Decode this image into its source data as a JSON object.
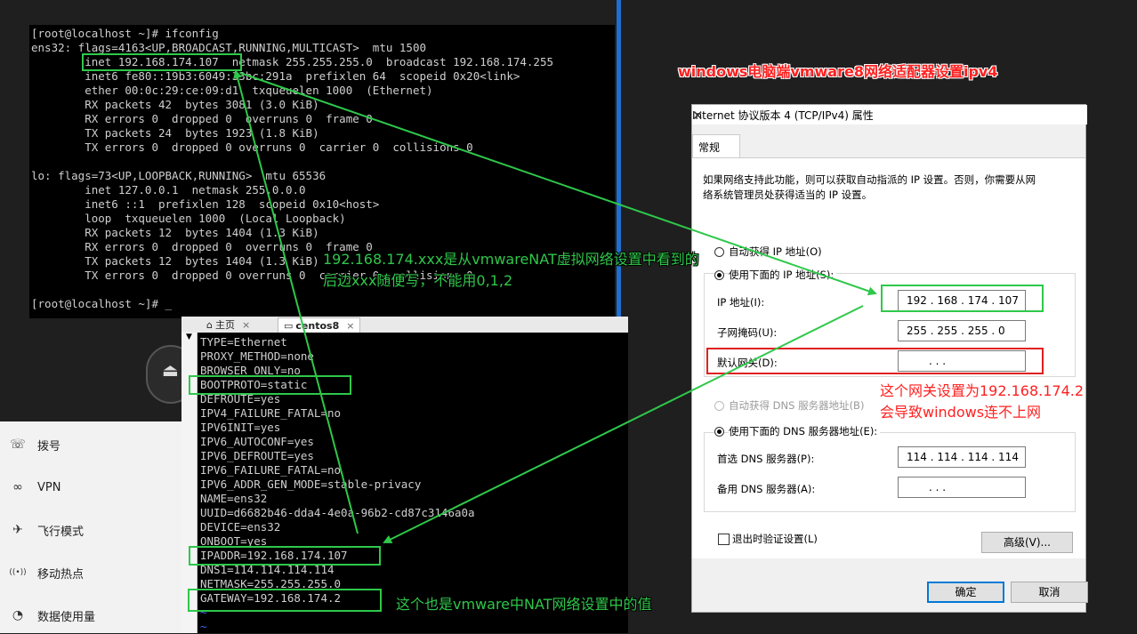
{
  "terminal": {
    "lines": [
      "[root@localhost ~]# ifconfig",
      "ens32: flags=4163<UP,BROADCAST,RUNNING,MULTICAST>  mtu 1500",
      "        inet 192.168.174.107  netmask 255.255.255.0  broadcast 192.168.174.255",
      "        inet6 fe80::19b3:6049:33bc:291a  prefixlen 64  scopeid 0x20<link>",
      "        ether 00:0c:29:ce:09:d1  txqueuelen 1000  (Ethernet)",
      "        RX packets 42  bytes 3081 (3.0 KiB)",
      "        RX errors 0  dropped 0  overruns 0  frame 0",
      "        TX packets 24  bytes 1923 (1.8 KiB)",
      "        TX errors 0  dropped 0 overruns 0  carrier 0  collisions 0",
      "",
      "lo: flags=73<UP,LOOPBACK,RUNNING>  mtu 65536",
      "        inet 127.0.0.1  netmask 255.0.0.0",
      "        inet6 ::1  prefixlen 128  scopeid 0x10<host>",
      "        loop  txqueuelen 1000  (Local Loopback)",
      "        RX packets 12  bytes 1404 (1.3 KiB)",
      "        RX errors 0  dropped 0  overruns 0  frame 0",
      "        TX packets 12  bytes 1404 (1.3 KiB)",
      "        TX errors 0  dropped 0 overruns 0  carrier 0  collisions 0",
      "",
      "[root@localhost ~]# _"
    ]
  },
  "side_menu": {
    "items": [
      {
        "icon": "dialup-icon",
        "label": "拨号"
      },
      {
        "icon": "vpn-icon",
        "label": "VPN"
      },
      {
        "icon": "airplane-icon",
        "label": "飞行模式"
      },
      {
        "icon": "hotspot-icon",
        "label": "移动热点"
      },
      {
        "icon": "data-usage-icon",
        "label": "数据使用量"
      }
    ]
  },
  "vm_window": {
    "tabs": [
      {
        "label": "主页",
        "icon": "home-icon"
      },
      {
        "label": "centos8",
        "icon": "vm-icon"
      }
    ],
    "lines": [
      "TYPE=Ethernet",
      "PROXY_METHOD=none",
      "BROWSER_ONLY=no",
      "BOOTPROTO=static",
      "DEFROUTE=yes",
      "IPV4_FAILURE_FATAL=no",
      "IPV6INIT=yes",
      "IPV6_AUTOCONF=yes",
      "IPV6_DEFROUTE=yes",
      "IPV6_FAILURE_FATAL=no",
      "IPV6_ADDR_GEN_MODE=stable-privacy",
      "NAME=ens32",
      "UUID=d6682b46-dda4-4e0a-96b2-cd87c3146a0a",
      "DEVICE=ens32",
      "ONBOOT=yes",
      "IPADDR=192.168.174.107",
      "DNS1=114.114.114.114",
      "NETMASK=255.255.255.0",
      "GATEWAY=192.168.174.2",
      "~",
      "~"
    ]
  },
  "dialog": {
    "title": "Internet 协议版本 4 (TCP/IPv4) 属性",
    "tab": "常规",
    "intro_line1": "如果网络支持此功能，则可以获取自动指派的 IP 设置。否则，你需要从网",
    "intro_line2": "络系统管理员处获得适当的 IP 设置。",
    "radio_auto_ip": "自动获得 IP 地址(O)",
    "radio_manual_ip": "使用下面的 IP 地址(S):",
    "ip_label": "IP 地址(I):",
    "ip_value": "192 . 168 . 174 . 107",
    "mask_label": "子网掩码(U):",
    "mask_value": "255 . 255 . 255 .  0",
    "gateway_label": "默认网关(D):",
    "gateway_value": ".       .       .",
    "radio_auto_dns": "自动获得 DNS 服务器地址(B)",
    "radio_manual_dns": "使用下面的 DNS 服务器地址(E):",
    "dns1_label": "首选 DNS 服务器(P):",
    "dns1_value": "114 . 114 . 114 . 114",
    "dns2_label": "备用 DNS 服务器(A):",
    "dns2_value": ".       .       .",
    "validate_label": "退出时验证设置(L)",
    "advanced_label": "高级(V)...",
    "ok_label": "确定",
    "cancel_label": "取消"
  },
  "annotations": {
    "title_red": "windows电脑端vmware8网络适配器设置ipv4",
    "note1_line1": "192.168.174.xxx是从vmwareNAT虚拟网络设置中看到的",
    "note1_line2": "后边xxx随便写，不能用0,1,2",
    "note2_line1": "这个网关设置为192.168.174.2",
    "note2_line2": "会导致windows连不上网",
    "note3": "这个也是vmware中NAT网络设置中的值"
  },
  "colors": {
    "highlight_green": "#2ec84a",
    "highlight_red": "#e02020",
    "terminal_bg": "#000000",
    "separator_blue": "#1e6fd1"
  }
}
